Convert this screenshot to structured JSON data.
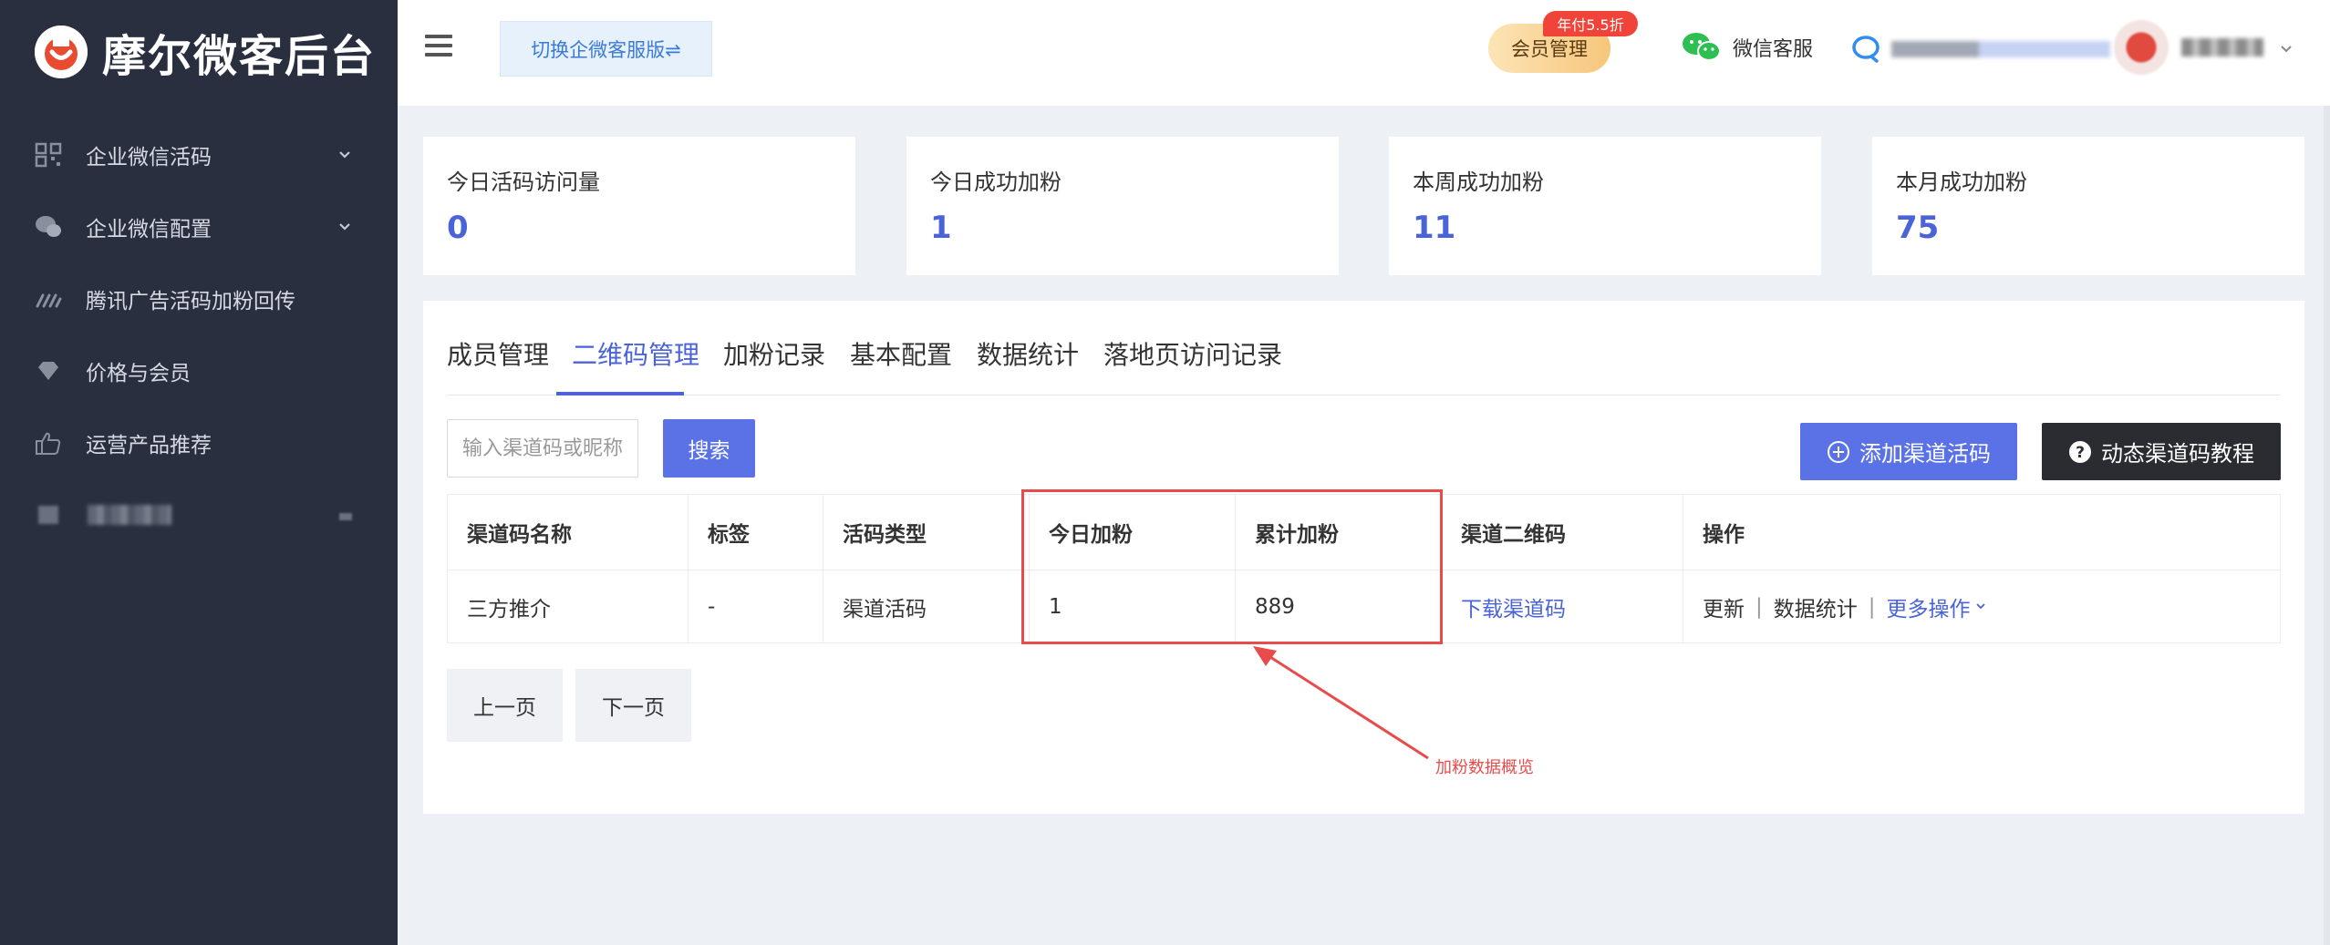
{
  "app": {
    "logo_text": "摩尔微客后台"
  },
  "sidebar": {
    "items": [
      {
        "label": "企业微信活码",
        "icon": "qrcode-icon",
        "expandable": true
      },
      {
        "label": "企业微信配置",
        "icon": "chat-bubbles-icon",
        "expandable": true
      },
      {
        "label": "腾讯广告活码加粉回传",
        "icon": "slashes-icon",
        "expandable": false
      },
      {
        "label": "价格与会员",
        "icon": "diamond-icon",
        "expandable": false
      },
      {
        "label": "运营产品推荐",
        "icon": "thumbs-up-icon",
        "expandable": false
      }
    ]
  },
  "header": {
    "switch_label": "切换企微客服版⇌",
    "member_label": "会员管理",
    "promo_badge": "年付5.5折",
    "wechat_service_label": "微信客服"
  },
  "stats": [
    {
      "title": "今日活码访问量",
      "value": "0"
    },
    {
      "title": "今日成功加粉",
      "value": "1"
    },
    {
      "title": "本周成功加粉",
      "value": "11"
    },
    {
      "title": "本月成功加粉",
      "value": "75"
    }
  ],
  "tabs": [
    {
      "label": "成员管理",
      "active": false
    },
    {
      "label": "二维码管理",
      "active": true
    },
    {
      "label": "加粉记录",
      "active": false
    },
    {
      "label": "基本配置",
      "active": false
    },
    {
      "label": "数据统计",
      "active": false
    },
    {
      "label": "落地页访问记录",
      "active": false
    }
  ],
  "toolbar": {
    "search_placeholder": "输入渠道码或昵称",
    "search_label": "搜索",
    "add_label": "添加渠道活码",
    "help_label": "动态渠道码教程"
  },
  "table": {
    "headers": [
      "渠道码名称",
      "标签",
      "活码类型",
      "今日加粉",
      "累计加粉",
      "渠道二维码",
      "操作"
    ],
    "rows": [
      {
        "name": "三方推介",
        "tag": "-",
        "type": "渠道活码",
        "today": "1",
        "total": "889",
        "qrcode_link": "下载渠道码",
        "actions": {
          "update": "更新",
          "stats": "数据统计",
          "more": "更多操作"
        }
      }
    ]
  },
  "pagination": {
    "prev": "上一页",
    "next": "下一页"
  },
  "annotation": {
    "text": "加粉数据概览"
  },
  "colors": {
    "accent": "#4a63d8",
    "sidebar_bg": "#2a2f40",
    "highlight": "#e84b4b"
  }
}
